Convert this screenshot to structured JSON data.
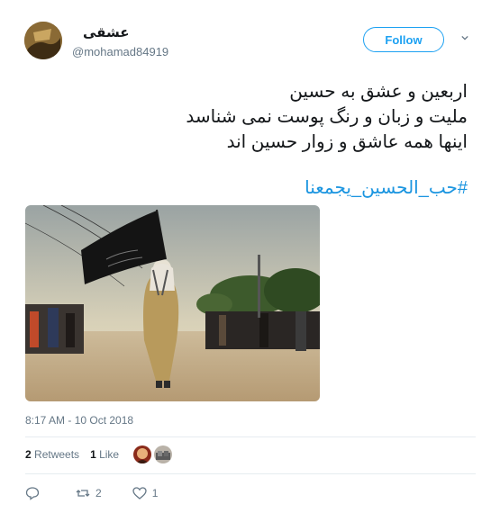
{
  "user": {
    "display_name": "عشقی",
    "handle": "@mohamad84919"
  },
  "follow_label": "Follow",
  "tweet": {
    "lines": [
      "اربعین و عشق به حسین",
      "ملیت و زبان و رنگ پوست نمی شناسد",
      "اینها همه عاشق و زوار حسین اند"
    ],
    "hashtag": "#حب_الحسین_یجمعنا"
  },
  "timestamp": "8:17 AM - 10 Oct 2018",
  "stats": {
    "retweets_count": "2",
    "retweets_label": "Retweets",
    "likes_count": "1",
    "likes_label": "Like"
  },
  "actions": {
    "reply_count": "",
    "retweet_count": "2",
    "like_count": "1"
  },
  "colors": {
    "accent": "#1da1f2",
    "hashtag": "#1b95e0",
    "muted": "#657786"
  },
  "icons": [
    "chevron-down-icon",
    "reply-icon",
    "retweet-icon",
    "heart-icon"
  ]
}
